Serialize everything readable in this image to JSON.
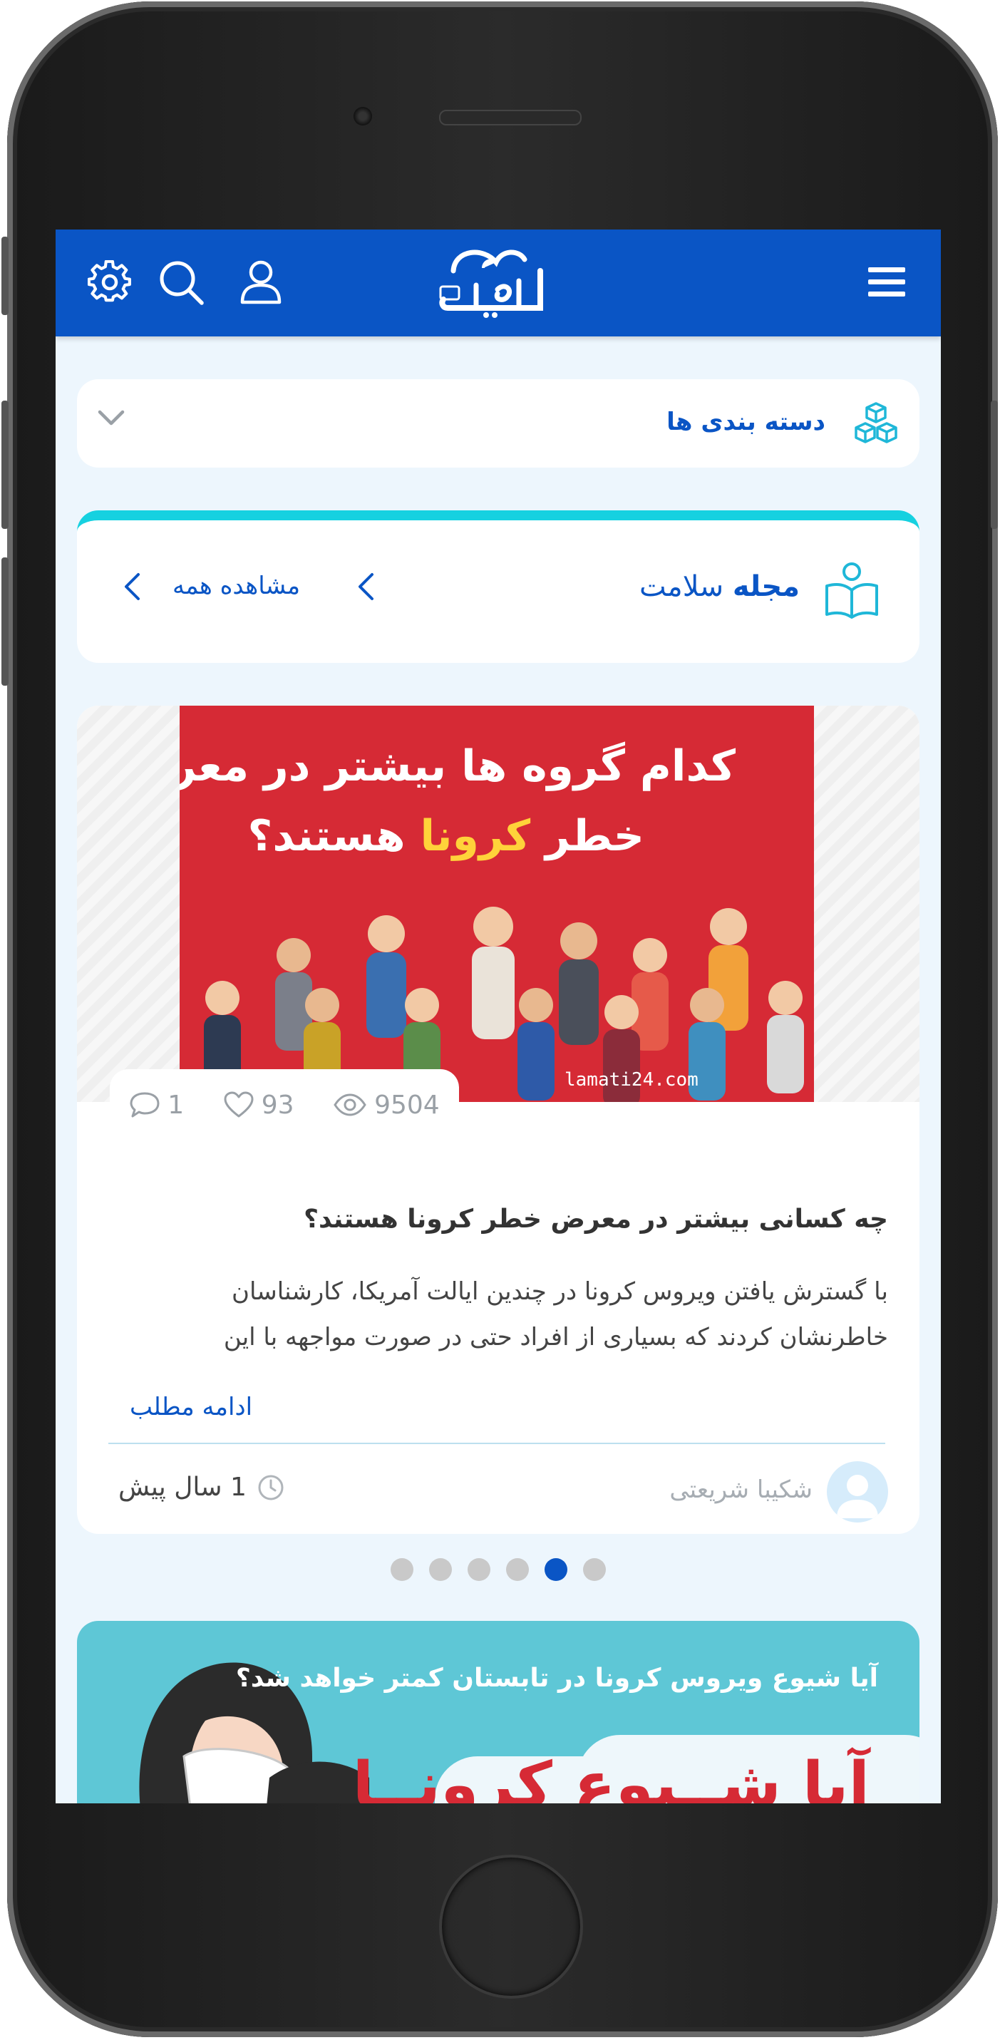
{
  "header": {
    "menu_icon": "hamburger-menu-icon",
    "logo_text": "سلامتی24",
    "icons": [
      "user-icon",
      "search-icon",
      "gear-icon"
    ]
  },
  "categories": {
    "label": "دسته بندی ها",
    "icon": "cubes-icon",
    "toggle_icon": "chevron-down-icon"
  },
  "magazine": {
    "title_bold": "مجله",
    "title_rest": " سلامت",
    "view_all": "مشاهده همه",
    "accent": "#16d1e0"
  },
  "post": {
    "image_line1": "کدام گروه ها بیشتر در معرض",
    "image_line2_a": "خطر ",
    "image_line2_b": "کرونا",
    "image_line2_c": " هستند؟",
    "image_watermark": "lamati24.com",
    "comments": "1",
    "likes": "93",
    "views": "9504",
    "title": "چه کسانی بیشتر در معرض خطر کرونا هستند؟",
    "excerpt": "با گسترش یافتن ویروس کرونا در چندین ایالت آمریکا، کارشناسان خاطرنشان کردند که بسیاری از افراد حتی در صورت مواجهه با این",
    "read_more": "ادامه مطلب",
    "author": "شکیبا شریعتی",
    "time": "1 سال پیش"
  },
  "carousel": {
    "dot_count": 6,
    "active_index": 4
  },
  "promo": {
    "caption": "آیا شیوع ویروس کرونا در تابستان کمتر خواهد شد؟",
    "big_text": "آیا شــیوع کرونــا"
  },
  "colors": {
    "brand": "#0a55c5",
    "background": "#edf6fd",
    "hero_red": "#d62a35"
  }
}
